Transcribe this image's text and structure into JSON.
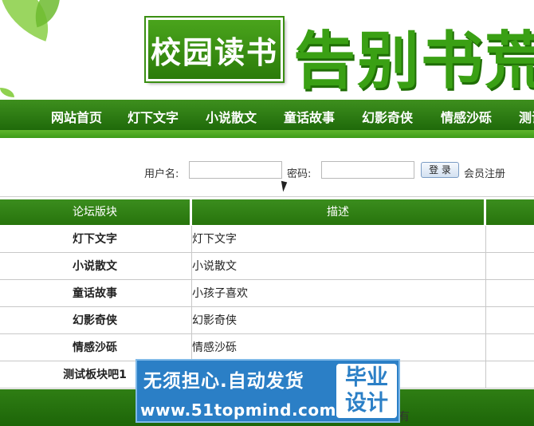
{
  "header": {
    "logo_text": "校园读书",
    "slogan": "告别书荒"
  },
  "nav": {
    "items": [
      "网站首页",
      "灯下文字",
      "小说散文",
      "童话故事",
      "幻影奇侠",
      "情感沙砾",
      "测试"
    ]
  },
  "login": {
    "username_label": "用户名:",
    "username_value": "",
    "password_label": "密码:",
    "password_value": "",
    "login_button": "登 录",
    "register_link": "会员注册"
  },
  "forum_table": {
    "headers": [
      "论坛版块",
      "描述",
      ""
    ],
    "rows": [
      {
        "section": "灯下文字",
        "description": "灯下文字"
      },
      {
        "section": "小说散文",
        "description": "小说散文"
      },
      {
        "section": "童话故事",
        "description": "小孩子喜欢"
      },
      {
        "section": "幻影奇侠",
        "description": "幻影奇侠"
      },
      {
        "section": "情感沙砾",
        "description": "情感沙砾"
      },
      {
        "section": "测试板块吧1",
        "description": ""
      }
    ]
  },
  "footer": {
    "text": "有"
  },
  "watermark": {
    "line1": "无须担心.自动发货",
    "line2": "www.51topmind.com",
    "badge_line1": "毕业",
    "badge_line2": "设计"
  }
}
